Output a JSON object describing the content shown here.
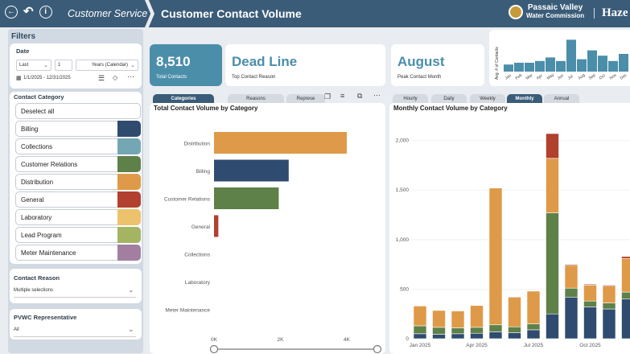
{
  "header": {
    "breadcrumb": "Customer Service",
    "title": "Customer Contact Volume",
    "logo_line1": "Passaic Valley",
    "logo_line2": "Water Commission",
    "right_text": "Haze",
    "colors": {
      "bar": "#3a5c78"
    }
  },
  "filters": {
    "title": "Filters",
    "date": {
      "label": "Date",
      "mode": "Last",
      "count": "1",
      "unit": "Years (Calendar)",
      "range": "1/1/2025 - 12/31/2025"
    },
    "category": {
      "label": "Contact Category",
      "deselect": "Deselect all",
      "items": [
        {
          "label": "Billing",
          "color": "#2f4b6f"
        },
        {
          "label": "Collections",
          "color": "#74a7b4"
        },
        {
          "label": "Customer Relations",
          "color": "#5e8049"
        },
        {
          "label": "Distribution",
          "color": "#de9a48"
        },
        {
          "label": "General",
          "color": "#b1402e"
        },
        {
          "label": "Laboratory",
          "color": "#edc26d"
        },
        {
          "label": "Lead Program",
          "color": "#a4b463"
        },
        {
          "label": "Meter Maintenance",
          "color": "#a27fa0"
        }
      ]
    },
    "reason": {
      "label": "Contact Reason",
      "value": "Multiple selections"
    },
    "rep": {
      "label": "PVWC Representative",
      "value": "All"
    }
  },
  "kpis": {
    "total_value": "8,510",
    "total_label": "Total Contacts",
    "reason_value": "Dead Line",
    "reason_label": "Top Contact Reason",
    "month_value": "August",
    "month_label": "Peak Contact Month"
  },
  "left_tabs": [
    "Categories",
    "Reasons",
    "Represe"
  ],
  "right_tabs": [
    "Hourly",
    "Daily",
    "Weekly",
    "Monthly",
    "Annual"
  ],
  "chart_data": [
    {
      "type": "bar",
      "title": "Total Contact Volume by Category",
      "orientation": "horizontal",
      "categories": [
        "Distribution",
        "Billing",
        "Customer Relations",
        "General",
        "Collections",
        "Laboratory",
        "Meter Maintenance"
      ],
      "values": [
        4000,
        2250,
        1950,
        130,
        0,
        0,
        0
      ],
      "colors": [
        "#de9a48",
        "#2f4b6f",
        "#5e8049",
        "#b1402e",
        "#74a7b4",
        "#edc26d",
        "#a27fa0"
      ],
      "xticks": [
        "0K",
        "2K",
        "4K"
      ],
      "xlim": [
        0,
        4400
      ]
    },
    {
      "type": "bar",
      "stacked": true,
      "title": "Monthly Contact Volume by Category",
      "categories": [
        "Jan 2025",
        "Feb 2025",
        "Mar 2025",
        "Apr 2025",
        "May 2025",
        "Jun 2025",
        "Jul 2025",
        "Aug 2025",
        "Sep 2025",
        "Oct 2025",
        "Nov 2025",
        "Dec 2025"
      ],
      "xticks": [
        "Jan 2025",
        "Apr 2025",
        "Jul 2025",
        "Oct 2025"
      ],
      "yticks": [
        "0",
        "500",
        "1,000",
        "1,500",
        "2,000"
      ],
      "ylim": [
        0,
        2200
      ],
      "series": [
        {
          "name": "Billing",
          "color": "#2f4b6f",
          "values": [
            50,
            45,
            50,
            55,
            70,
            60,
            90,
            250,
            420,
            320,
            300,
            400
          ]
        },
        {
          "name": "Customer Relations",
          "color": "#5e8049",
          "values": [
            80,
            70,
            60,
            60,
            70,
            60,
            60,
            1020,
            90,
            60,
            60,
            70
          ]
        },
        {
          "name": "Distribution",
          "color": "#de9a48",
          "values": [
            200,
            170,
            170,
            220,
            1380,
            300,
            330,
            550,
            230,
            160,
            170,
            340
          ]
        },
        {
          "name": "General",
          "color": "#b1402e",
          "values": [
            0,
            0,
            0,
            0,
            0,
            0,
            0,
            250,
            10,
            10,
            10,
            20
          ]
        }
      ]
    },
    {
      "type": "bar",
      "title": "",
      "ylabel": "Avg. # of Contacts",
      "categories": [
        "Jan",
        "Feb",
        "Mar",
        "Apr",
        "May",
        "Jun",
        "Jul",
        "Aug",
        "Sep",
        "Oct",
        "Nov",
        "Dec"
      ],
      "values": [
        4,
        5,
        5,
        6,
        8,
        6,
        18,
        7,
        12,
        9,
        6,
        10
      ]
    }
  ]
}
